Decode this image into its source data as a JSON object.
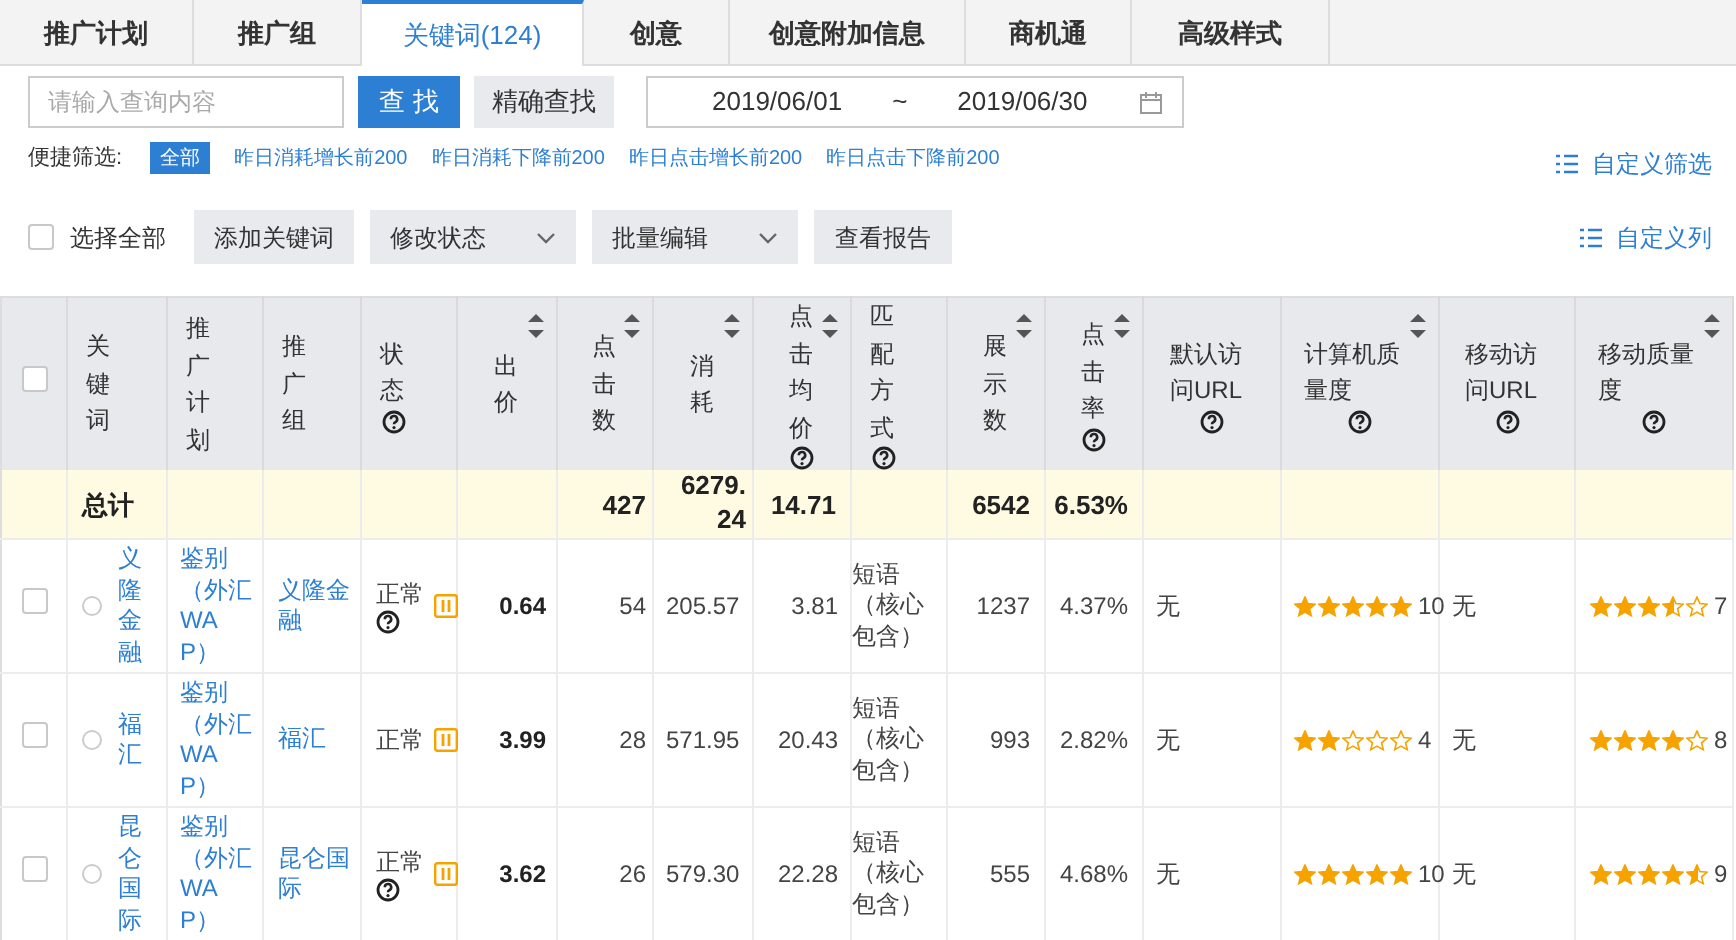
{
  "tabs": [
    {
      "label": "推广计划",
      "selected": false
    },
    {
      "label": "推广组",
      "selected": false
    },
    {
      "label": "关键词(124)",
      "selected": true
    },
    {
      "label": "创意",
      "selected": false
    },
    {
      "label": "创意附加信息",
      "selected": false
    },
    {
      "label": "商机通",
      "selected": false
    },
    {
      "label": "高级样式",
      "selected": false
    }
  ],
  "search": {
    "placeholder": "请输入查询内容",
    "search_button": "查 找",
    "exact_button": "精确查找"
  },
  "date_range": {
    "start": "2019/06/01",
    "separator": "~",
    "end": "2019/06/30"
  },
  "quick_filter": {
    "label": "便捷筛选:",
    "options": [
      {
        "label": "全部",
        "selected": true
      },
      {
        "label": "昨日消耗增长前200",
        "selected": false
      },
      {
        "label": "昨日消耗下降前200",
        "selected": false
      },
      {
        "label": "昨日点击增长前200",
        "selected": false
      },
      {
        "label": "昨日点击下降前200",
        "selected": false
      }
    ],
    "custom_filter": "自定义筛选"
  },
  "actions": {
    "select_all": {
      "label": "选择全部",
      "checked": false
    },
    "add_keyword": "添加关键词",
    "modify_status": "修改状态",
    "batch_edit": "批量编辑",
    "view_report": "查看报告",
    "custom_columns": "自定义列"
  },
  "table": {
    "header_checkbox": {
      "checked": false
    },
    "columns": [
      {
        "label": "关键词",
        "sortable": false,
        "help": false
      },
      {
        "label": "推广计划",
        "sortable": false,
        "help": false
      },
      {
        "label": "推广组",
        "sortable": false,
        "help": false
      },
      {
        "label": "状态",
        "sortable": false,
        "help": true
      },
      {
        "label": "出价",
        "sortable": true,
        "help": false
      },
      {
        "label": "点击数",
        "sortable": true,
        "help": false
      },
      {
        "label": "消耗",
        "sortable": true,
        "help": false
      },
      {
        "label": "点击均价",
        "sortable": true,
        "help": true
      },
      {
        "label": "匹配方式",
        "sortable": false,
        "help": true
      },
      {
        "label": "展示数",
        "sortable": true,
        "help": false
      },
      {
        "label": "点击率",
        "sortable": true,
        "help": true
      },
      {
        "label": "默认访问URL",
        "sortable": false,
        "help": true
      },
      {
        "label": "计算机质量度",
        "sortable": true,
        "help": true
      },
      {
        "label": "移动访问URL",
        "sortable": false,
        "help": true
      },
      {
        "label": "移动质量度",
        "sortable": true,
        "help": true
      }
    ],
    "total": {
      "label": "总计",
      "clicks": "427",
      "cost": "6279.24",
      "avg_price": "14.71",
      "impressions": "6542",
      "ctr": "6.53%"
    },
    "rows": [
      {
        "checked": false,
        "selected": false,
        "keyword": "义隆金融",
        "plan": "鉴别（外汇WAP）",
        "group": "义隆金融",
        "status": "正常",
        "status_help": true,
        "bid": "0.64",
        "clicks": "54",
        "cost": "205.57",
        "avg_price": "3.81",
        "match": "短语（核心包含）",
        "impressions": "1237",
        "ctr": "4.37%",
        "pc_url": "无",
        "pc_quality": {
          "stars": 5,
          "score": "10"
        },
        "mobile_url": "无",
        "mobile_quality": {
          "stars": 3.5,
          "score": "7"
        }
      },
      {
        "checked": false,
        "selected": false,
        "keyword": "福汇",
        "plan": "鉴别（外汇WAP）",
        "group": "福汇",
        "status": "正常",
        "status_help": false,
        "bid": "3.99",
        "clicks": "28",
        "cost": "571.95",
        "avg_price": "20.43",
        "match": "短语（核心包含）",
        "impressions": "993",
        "ctr": "2.82%",
        "pc_url": "无",
        "pc_quality": {
          "stars": 2,
          "score": "4"
        },
        "mobile_url": "无",
        "mobile_quality": {
          "stars": 4,
          "score": "8"
        }
      },
      {
        "checked": false,
        "selected": false,
        "keyword": "昆仑国际",
        "plan": "鉴别（外汇WAP）",
        "group": "昆仑国际",
        "status": "正常",
        "status_help": true,
        "bid": "3.62",
        "clicks": "26",
        "cost": "579.30",
        "avg_price": "22.28",
        "match": "短语（核心包含）",
        "impressions": "555",
        "ctr": "4.68%",
        "pc_url": "无",
        "pc_quality": {
          "stars": 5,
          "score": "10"
        },
        "mobile_url": "无",
        "mobile_quality": {
          "stars": 4.5,
          "score": "9"
        }
      }
    ]
  }
}
